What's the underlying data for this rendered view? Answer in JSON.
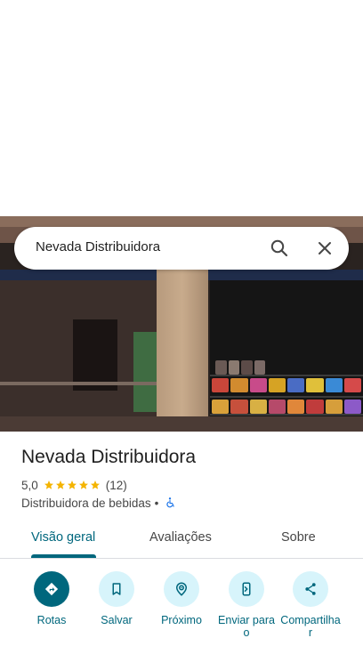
{
  "search": {
    "query": "Nevada Distribuidora"
  },
  "place": {
    "name": "Nevada Distribuidora",
    "rating": "5,0",
    "stars": 5,
    "review_count": "(12)",
    "category": "Distribuidora de bebidas",
    "separator": "•"
  },
  "tabs": [
    {
      "label": "Visão geral",
      "active": true
    },
    {
      "label": "Avaliações",
      "active": false
    },
    {
      "label": "Sobre",
      "active": false
    }
  ],
  "actions": [
    {
      "label": "Rotas",
      "icon": "directions-icon"
    },
    {
      "label": "Salvar",
      "icon": "bookmark-icon"
    },
    {
      "label": "Próximo",
      "icon": "nearby-icon"
    },
    {
      "label": "Enviar para o",
      "icon": "send-to-phone-icon"
    },
    {
      "label": "Compartilha r",
      "icon": "share-icon"
    }
  ],
  "colors": {
    "accent": "#00677d",
    "accent_light": "#d7f4fb",
    "star": "#f4b400",
    "access": "#1a73e8"
  }
}
